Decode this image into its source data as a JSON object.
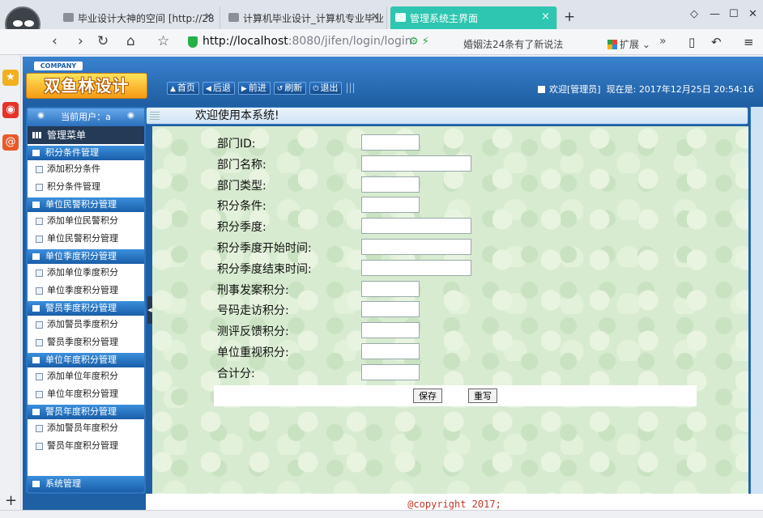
{
  "browser": {
    "tabs": [
      {
        "label": "毕业设计大神的空间 [http://28",
        "active": false
      },
      {
        "label": "计算机毕业设计_计算机专业毕业",
        "active": false
      },
      {
        "label": "管理系统主界面",
        "active": true
      }
    ],
    "tab_close": "×",
    "new_tab": "+",
    "window_controls": [
      "◇",
      "—",
      "☐",
      "✕"
    ],
    "nav": {
      "back": "‹",
      "forward": "›",
      "reload": "↻",
      "home": "⌂",
      "star": "☆"
    },
    "url_host": "http://localhost",
    "url_path": ":8080/jifen/login/login",
    "search_hint": "婚姻法24条有了新说法",
    "extension_label": "扩展",
    "more": "»",
    "right_icons": [
      "▯",
      "↶",
      "≡"
    ],
    "strip_icons": [
      {
        "name": "star",
        "color": "#f2b01e",
        "glyph": "★"
      },
      {
        "name": "weibo",
        "color": "#e6332a",
        "glyph": "◉"
      },
      {
        "name": "at",
        "color": "#e85a2a",
        "glyph": "@"
      }
    ],
    "new_panel": "+",
    "colors": {
      "active_tab": "#2ec6b0",
      "url_secure": "#25b04a"
    }
  },
  "header": {
    "company": "COMPANY",
    "logo_text": "双鱼林设计",
    "nav": [
      {
        "icon": "▲",
        "label": "首页"
      },
      {
        "icon": "◀",
        "label": "后退"
      },
      {
        "icon": "▶",
        "label": "前进"
      },
      {
        "icon": "↺",
        "label": "刷新"
      },
      {
        "icon": "⏻",
        "label": "退出"
      }
    ],
    "nav_sep": "|||",
    "welcome": "欢迎[管理员]",
    "now_label": "现在是:",
    "datetime": "2017年12月25日 20:54:16"
  },
  "menu": {
    "current_user": "当前用户：a",
    "title": "管理菜单",
    "groups": [
      {
        "label": "积分条件管理",
        "items": [
          "添加积分条件",
          "积分条件管理"
        ]
      },
      {
        "label": "单位民警积分管理",
        "items": [
          "添加单位民警积分",
          "单位民警积分管理"
        ]
      },
      {
        "label": "单位季度积分管理",
        "items": [
          "添加单位季度积分",
          "单位季度积分管理"
        ]
      },
      {
        "label": "警员季度积分管理",
        "items": [
          "添加警员季度积分",
          "警员季度积分管理"
        ]
      },
      {
        "label": "单位年度积分管理",
        "items": [
          "添加单位年度积分",
          "单位年度积分管理"
        ]
      },
      {
        "label": "警员年度积分管理",
        "items": [
          "添加警员年度积分",
          "警员年度积分管理"
        ]
      }
    ],
    "system": "系统管理",
    "collapse": "◀"
  },
  "main": {
    "title": "欢迎使用本系统!",
    "fields": [
      {
        "label": "部门ID:",
        "value": "",
        "wide": false
      },
      {
        "label": "部门名称:",
        "value": "",
        "wide": true
      },
      {
        "label": "部门类型:",
        "value": "",
        "wide": false
      },
      {
        "label": "积分条件:",
        "value": "",
        "wide": false
      },
      {
        "label": "积分季度:",
        "value": "",
        "wide": true
      },
      {
        "label": "积分季度开始时间:",
        "value": "",
        "wide": true
      },
      {
        "label": "积分季度结束时间:",
        "value": "",
        "wide": true
      },
      {
        "label": "刑事发案积分:",
        "value": "",
        "wide": false
      },
      {
        "label": "号码走访积分:",
        "value": "",
        "wide": false
      },
      {
        "label": "测评反馈积分:",
        "value": "",
        "wide": false
      },
      {
        "label": "单位重视积分:",
        "value": "",
        "wide": false
      },
      {
        "label": "合计分:",
        "value": "",
        "wide": false
      }
    ],
    "save": "保存",
    "reset": "重写"
  },
  "footer": {
    "copyright": "@copyright 2017;"
  }
}
